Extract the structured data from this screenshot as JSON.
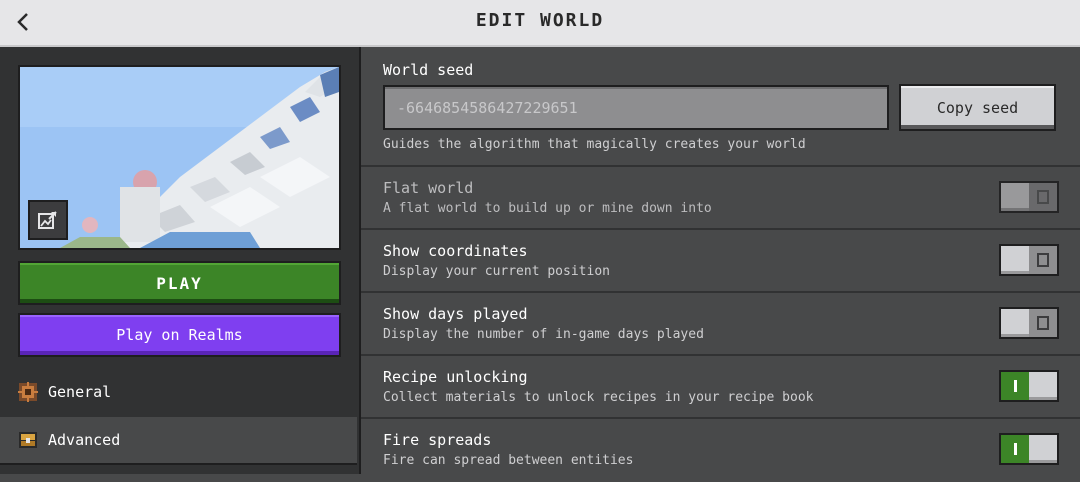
{
  "header": {
    "title": "EDIT WORLD",
    "back_icon": "chevron-left-icon"
  },
  "left": {
    "edit_image_icon": "edit-image-icon",
    "play_label": "PLAY",
    "realms_label": "Play on Realms",
    "nav": [
      {
        "label": "General",
        "icon": "gear-block-icon"
      },
      {
        "label": "Advanced",
        "icon": "chest-icon"
      }
    ]
  },
  "settings": {
    "seed": {
      "label": "World seed",
      "value": "-6646854586427229651",
      "copy_label": "Copy seed",
      "description": "Guides the algorithm that magically creates your world"
    },
    "toggles": [
      {
        "label": "Flat world",
        "description": "A flat world to build up or mine down into",
        "state": "off",
        "enabled": false
      },
      {
        "label": "Show coordinates",
        "description": "Display your current position",
        "state": "off",
        "enabled": true
      },
      {
        "label": "Show days played",
        "description": "Display the number of in-game days played",
        "state": "off",
        "enabled": true
      },
      {
        "label": "Recipe unlocking",
        "description": "Collect materials to unlock recipes in your recipe book",
        "state": "on",
        "enabled": true
      },
      {
        "label": "Fire spreads",
        "description": "Fire can spread between entities",
        "state": "on",
        "enabled": true
      }
    ]
  },
  "colors": {
    "play_green": "#3c8527",
    "realms_purple": "#7f3ff0",
    "panel_dark": "#313233",
    "panel_mid": "#48494a"
  }
}
